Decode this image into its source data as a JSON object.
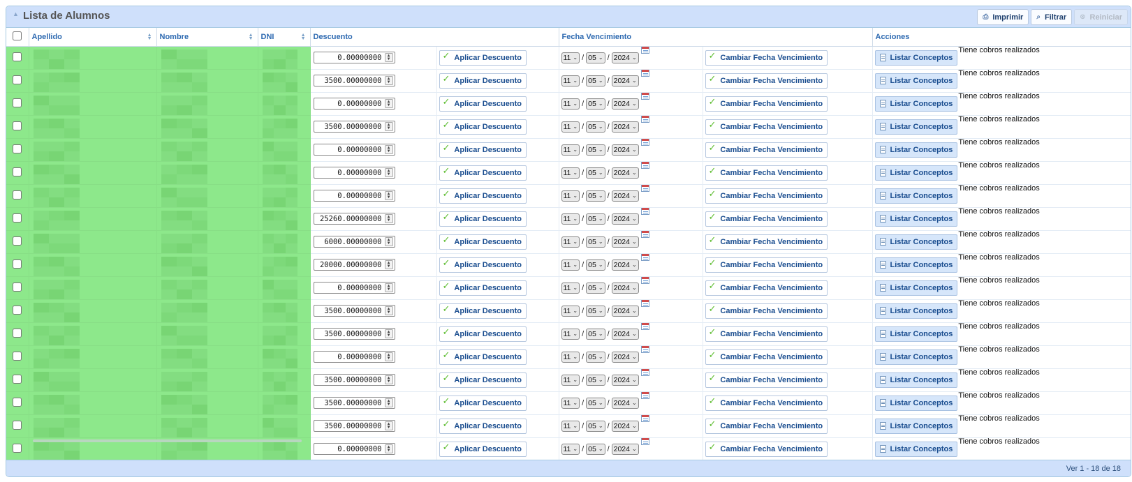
{
  "grid": {
    "title": "Lista de Alumnos",
    "toolbar": {
      "print_label": "Imprimir",
      "filter_label": "Filtrar",
      "reset_label": "Reiniciar"
    },
    "columns": {
      "apellido": "Apellido",
      "nombre": "Nombre",
      "dni": "DNI",
      "descuento": "Descuento",
      "fecha": "Fecha Vencimiento",
      "acciones": "Acciones"
    },
    "row_defaults": {
      "apply_label": "Aplicar Descuento",
      "change_date_label": "Cambiar Fecha Vencimiento",
      "list_label": "Listar Conceptos",
      "status_text": "Tiene cobros realizados",
      "day": "11",
      "month": "05",
      "year": "2024"
    },
    "rows": [
      {
        "discount": "0.00000000"
      },
      {
        "discount": "3500.00000000"
      },
      {
        "discount": "0.00000000"
      },
      {
        "discount": "3500.00000000"
      },
      {
        "discount": "0.00000000"
      },
      {
        "discount": "0.00000000"
      },
      {
        "discount": "0.00000000"
      },
      {
        "discount": "25260.00000000"
      },
      {
        "discount": "6000.00000000"
      },
      {
        "discount": "20000.00000000"
      },
      {
        "discount": "0.00000000"
      },
      {
        "discount": "3500.00000000"
      },
      {
        "discount": "3500.00000000"
      },
      {
        "discount": "0.00000000"
      },
      {
        "discount": "3500.00000000"
      },
      {
        "discount": "3500.00000000"
      },
      {
        "discount": "3500.00000000"
      },
      {
        "discount": "0.00000000"
      }
    ],
    "pager": "Ver 1 - 18 de 18"
  },
  "icons": {
    "collapse": "collapse-arrow-icon",
    "print": "print-icon",
    "filter": "search-icon",
    "reset": "reset-icon",
    "apply": "check-icon",
    "calendar": "calendar-icon",
    "list": "document-icon",
    "spinner": "spinner-icon"
  },
  "colors": {
    "header_bg": "#cfe0fb",
    "highlight": "#8de88b",
    "link": "#1a4d8f"
  }
}
